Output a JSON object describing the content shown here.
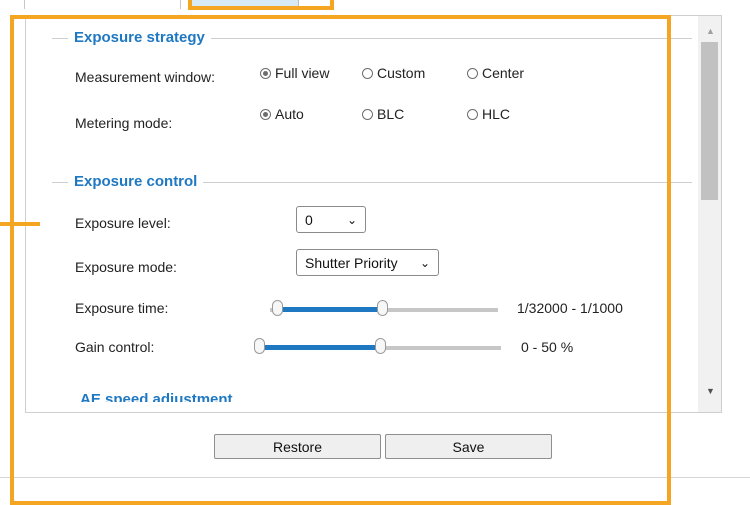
{
  "exposure_strategy": {
    "title": "Exposure strategy",
    "measurement_window": {
      "label": "Measurement window:",
      "options": [
        "Full view",
        "Custom",
        "Center"
      ],
      "selected": "Full view"
    },
    "metering_mode": {
      "label": "Metering mode:",
      "options": [
        "Auto",
        "BLC",
        "HLC"
      ],
      "selected": "Auto"
    }
  },
  "exposure_control": {
    "title": "Exposure control",
    "exposure_level": {
      "label": "Exposure level:",
      "value": "0"
    },
    "exposure_mode": {
      "label": "Exposure mode:",
      "value": "Shutter Priority"
    },
    "exposure_time": {
      "label": "Exposure time:",
      "range": "1/32000 - 1/1000",
      "low": 0.03,
      "high": 0.49
    },
    "gain_control": {
      "label": "Gain control:",
      "range": "0 - 50 %",
      "low": 0.0,
      "high": 0.5
    }
  },
  "af_peek": {
    "title": "AE speed adjustment"
  },
  "buttons": {
    "restore": "Restore",
    "save": "Save"
  },
  "colors": {
    "accent": "#1e78c2",
    "highlight": "#f4a623"
  }
}
